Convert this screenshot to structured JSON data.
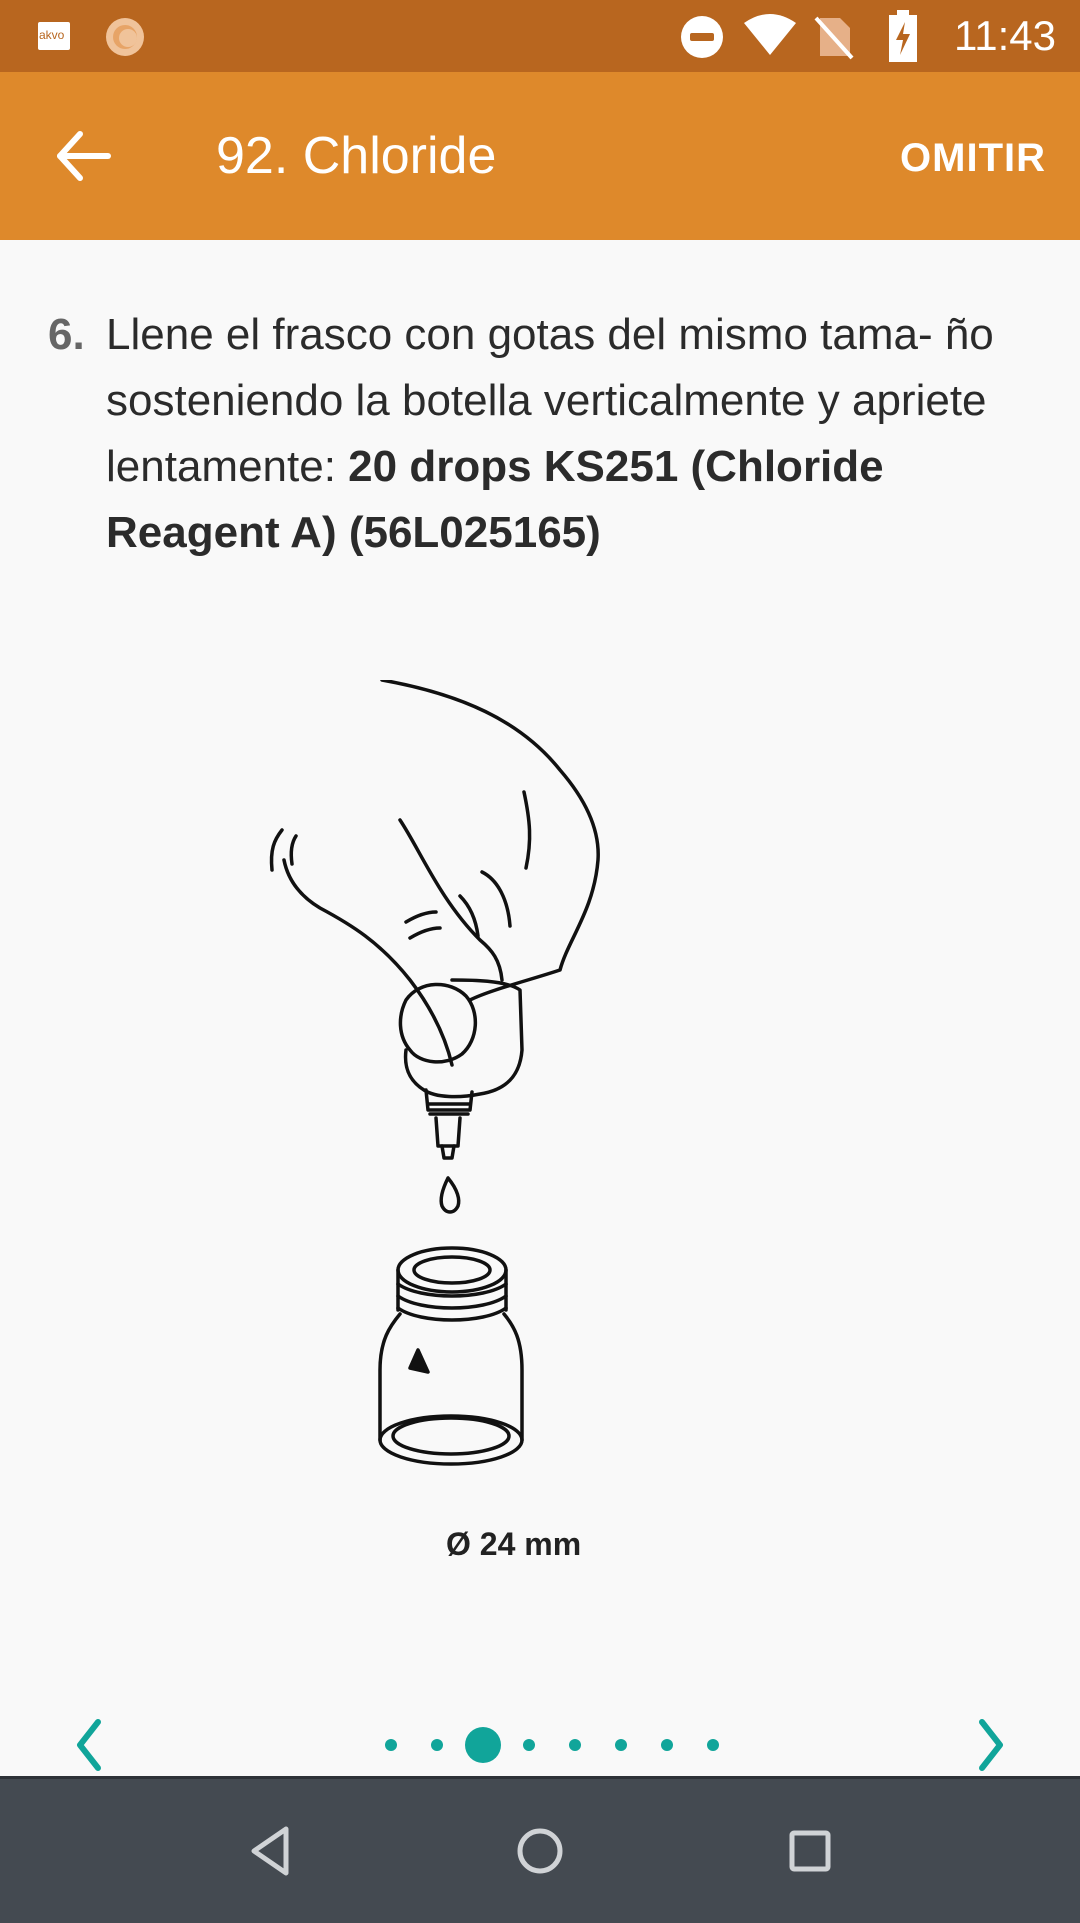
{
  "status_bar": {
    "time": "11:43",
    "app_badge": "akvo",
    "icons": [
      "akvo-app-icon",
      "sun-app-icon",
      "do-not-disturb-icon",
      "wifi-icon",
      "no-sim-icon",
      "battery-charging-icon"
    ]
  },
  "app_bar": {
    "title": "92. Chloride",
    "skip_label": "OMITIR",
    "back_icon": "arrow-back-icon"
  },
  "instruction": {
    "number": "6.",
    "text_plain": "Llene el frasco con gotas del mismo tama- ño sosteniendo la botella verticalmente y apriete lentamente: ",
    "text_bold": "20 drops KS251 (Chloride Reagent A) (56L025165)"
  },
  "illustration": {
    "caption": "Ø 24 mm"
  },
  "pager": {
    "prev_icon": "chevron-left-icon",
    "next_icon": "chevron-right-icon",
    "page_count": 8,
    "current_index": 2
  },
  "nav_bar": {
    "icons": [
      "back-triangle-icon",
      "home-circle-icon",
      "recents-square-icon"
    ]
  },
  "colors": {
    "status_bar": "#b8661f",
    "app_bar": "#de892b",
    "accent": "#11a59a",
    "nav_bar": "#444a51"
  }
}
